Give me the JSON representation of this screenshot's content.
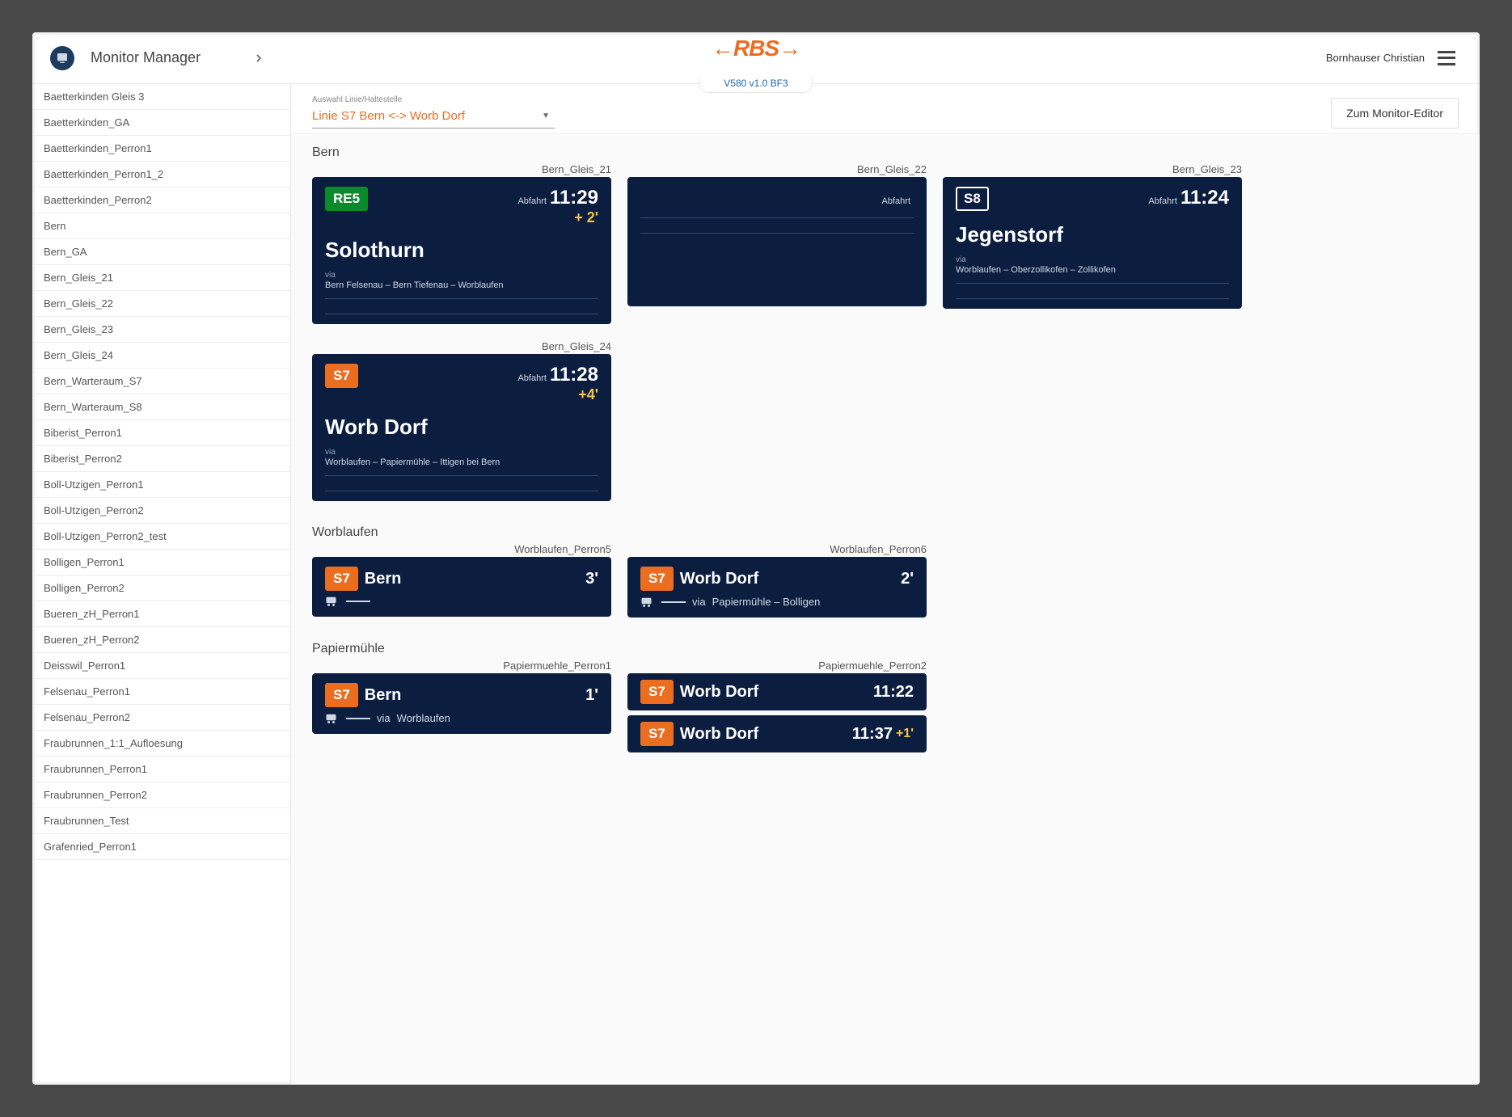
{
  "header": {
    "app_title": "Monitor Manager",
    "brand": "RBS",
    "version": "V580 v1.0 BF3",
    "user": "Bornhauser Christian"
  },
  "toolbar": {
    "select_label": "Auswahl Linie/Haltestelle",
    "select_value": "Linie S7 Bern <-> Worb Dorf",
    "editor_label": "Zum Monitor-Editor"
  },
  "colors": {
    "accent_orange": "#eb6d20",
    "card_bg": "#0c1e40",
    "delay": "#f6c445",
    "badge_green": "#0a8a2a"
  },
  "sidebar": {
    "items": [
      "Baetterkinden Gleis 3",
      "Baetterkinden_GA",
      "Baetterkinden_Perron1",
      "Baetterkinden_Perron1_2",
      "Baetterkinden_Perron2",
      "Bern",
      "Bern_GA",
      "Bern_Gleis_21",
      "Bern_Gleis_22",
      "Bern_Gleis_23",
      "Bern_Gleis_24",
      "Bern_Warteraum_S7",
      "Bern_Warteraum_S8",
      "Biberist_Perron1",
      "Biberist_Perron2",
      "Boll-Utzigen_Perron1",
      "Boll-Utzigen_Perron2",
      "Boll-Utzigen_Perron2_test",
      "Bolligen_Perron1",
      "Bolligen_Perron2",
      "Bueren_zH_Perron1",
      "Bueren_zH_Perron2",
      "Deisswil_Perron1",
      "Felsenau_Perron1",
      "Felsenau_Perron2",
      "Fraubrunnen_1:1_Aufloesung",
      "Fraubrunnen_Perron1",
      "Fraubrunnen_Perron2",
      "Fraubrunnen_Test",
      "Grafenried_Perron1"
    ]
  },
  "stations": [
    {
      "name": "Bern",
      "cards": [
        {
          "label": "Bern_Gleis_21",
          "size": "big",
          "line": "RE5",
          "line_style": "green",
          "abfahrt_label": "Abfahrt",
          "time": "11:29",
          "delay": "+ 2'",
          "dest": "Solothurn",
          "via_label": "via",
          "via": "Bern Felsenau – Bern Tiefenau – Worblaufen"
        },
        {
          "label": "Bern_Gleis_22",
          "size": "big",
          "line": "",
          "line_style": "",
          "abfahrt_label": "Abfahrt",
          "time": "",
          "delay": "",
          "dest": "",
          "via_label": "",
          "via": ""
        },
        {
          "label": "Bern_Gleis_23",
          "size": "big",
          "line": "S8",
          "line_style": "outline",
          "abfahrt_label": "Abfahrt",
          "time": "11:24",
          "delay": "",
          "dest": "Jegenstorf",
          "via_label": "via",
          "via": "Worblaufen – Oberzollikofen – Zollikofen"
        },
        {
          "label": "Bern_Gleis_24",
          "size": "big",
          "line": "S7",
          "line_style": "orange",
          "abfahrt_label": "Abfahrt",
          "time": "11:28",
          "delay": "+4'",
          "dest": "Worb Dorf",
          "via_label": "via",
          "via": "Worblaufen – Papiermühle – Ittigen bei Bern"
        }
      ]
    },
    {
      "name": "Worblaufen",
      "cards": [
        {
          "label": "Worblaufen_Perron5",
          "size": "small",
          "line": "S7",
          "line_style": "orange",
          "dest": "Bern",
          "due": "3'",
          "delay": "",
          "via_label": "",
          "via": ""
        },
        {
          "label": "Worblaufen_Perron6",
          "size": "small",
          "line": "S7",
          "line_style": "orange",
          "dest": "Worb Dorf",
          "due": "2'",
          "delay": "",
          "via_label": "via",
          "via": "Papiermühle – Bolligen"
        }
      ]
    },
    {
      "name": "Papiermühle",
      "cards": [
        {
          "label": "Papiermuehle_Perron1",
          "size": "small",
          "line": "S7",
          "line_style": "orange",
          "dest": "Bern",
          "due": "1'",
          "delay": "",
          "via_label": "via",
          "via": "Worblaufen"
        },
        {
          "label": "Papiermuehle_Perron2",
          "size": "stack",
          "rows": [
            {
              "line": "S7",
              "line_style": "orange",
              "dest": "Worb Dorf",
              "due": "11:22",
              "delay": ""
            },
            {
              "line": "S7",
              "line_style": "orange",
              "dest": "Worb Dorf",
              "due": "11:37",
              "delay": "+1'"
            }
          ]
        }
      ]
    }
  ]
}
